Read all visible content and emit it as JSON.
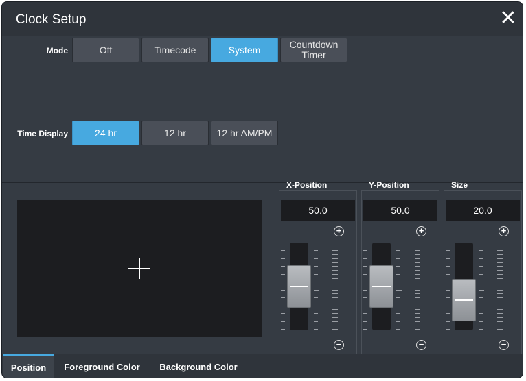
{
  "dialog": {
    "title": "Clock Setup"
  },
  "mode": {
    "label": "Mode",
    "options": [
      "Off",
      "Timecode",
      "System",
      "Countdown Timer"
    ],
    "selected": "System"
  },
  "time_display": {
    "label": "Time Display",
    "options": [
      "24 hr",
      "12 hr",
      "12 hr AM/PM"
    ],
    "selected": "24 hr"
  },
  "sliders": [
    {
      "label": "X-Position",
      "value": "50.0",
      "level": 0.5
    },
    {
      "label": "Y-Position",
      "value": "50.0",
      "level": 0.5
    },
    {
      "label": "Size",
      "value": "20.0",
      "level": 0.2
    }
  ],
  "tabs": {
    "items": [
      "Position",
      "Foreground Color",
      "Background Color"
    ],
    "active": "Position"
  },
  "icons": {
    "close": "close-icon",
    "plus": "plus-circle-icon",
    "minus": "minus-circle-icon",
    "crosshair": "crosshair-icon"
  },
  "colors": {
    "accent": "#47a9e0",
    "panel": "#353b43",
    "button": "#4a4f58"
  }
}
